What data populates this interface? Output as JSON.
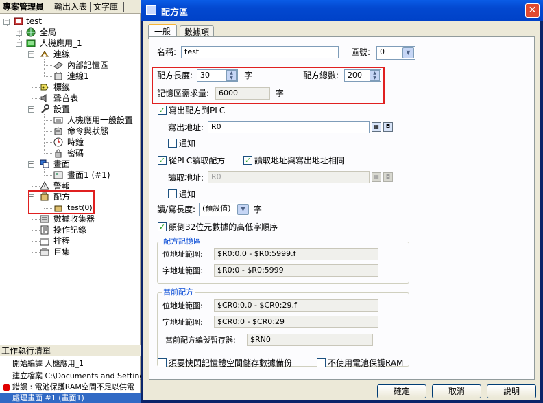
{
  "left_panel": {
    "tabs": [
      "專案管理員",
      "輸出入表",
      "文字庫"
    ],
    "tree": {
      "root": "test",
      "global": "全局",
      "hmi": "人機應用_1",
      "connection": "連線",
      "internal_memory": "內部記憶區",
      "connection1": "連線1",
      "tags": "標籤",
      "sound_table": "聲音表",
      "settings": "設置",
      "hmi_general": "人機應用一般設置",
      "command_status": "命令與狀態",
      "clock": "時鐘",
      "password": "密碼",
      "screens": "畫面",
      "screen1": "畫面1 (#1)",
      "alarm": "警報",
      "recipe": "配方",
      "recipe_test": "test(0)",
      "data_collector": "數據收集器",
      "operation_log": "操作記錄",
      "schedule": "排程",
      "macro": "巨集"
    },
    "worklist": {
      "header": "工作執行清單",
      "rows": [
        "開始編譯 人機應用_1",
        "建立檔案 C:\\Documents and Settings\\",
        "錯誤 : 電池保護RAM空間不足以供電",
        "處理畫面 #1 (畫面1)"
      ]
    }
  },
  "dialog": {
    "title": "配方區",
    "close_glyph": "✕",
    "tabs": [
      "一般",
      "數據項"
    ],
    "name_label": "名稱:",
    "name_value": "test",
    "area_label": "區號:",
    "area_value": "0",
    "recipe_length_label": "配方長度:",
    "recipe_length_value": "30",
    "unit_word": "字",
    "recipe_count_label": "配方總數:",
    "recipe_count_value": "200",
    "memory_needed_label": "記憶區需求量:",
    "memory_needed_value": "6000",
    "write_to_plc_label": "寫出配方到PLC",
    "write_address_label": "寫出地址:",
    "write_address_value": "R0",
    "notify_label": "通知",
    "read_from_plc_label": "從PLC讀取配方",
    "same_address_label": "讀取地址與寫出地址相同",
    "read_address_label": "讀取地址:",
    "read_address_value": "R0",
    "rw_length_label": "讀/寫長度:",
    "rw_length_value": "(預設值)",
    "reverse_order_label": "顛倒32位元數據的高低字順序",
    "recipe_memory_group": "配方記憶區",
    "bit_range_label": "位地址範圍:",
    "recipe_bit_range": "$R0:0.0 - $R0:5999.f",
    "word_range_label": "字地址範圍:",
    "recipe_word_range": "$R0:0 - $R0:5999",
    "current_recipe_group": "當前配方",
    "current_bit_range": "$CR0:0.0 - $CR0:29.f",
    "current_word_range": "$CR0:0 - $CR0:29",
    "current_recipe_no_label": "當前配方編號暫存器:",
    "current_recipe_no_value": "$RN0",
    "flash_backup_label": "須要快閃記憶體空間儲存數據備份",
    "no_battery_label": "不使用電池保護RAM",
    "ok_label": "確定",
    "cancel_label": "取消",
    "help_label": "說明"
  }
}
